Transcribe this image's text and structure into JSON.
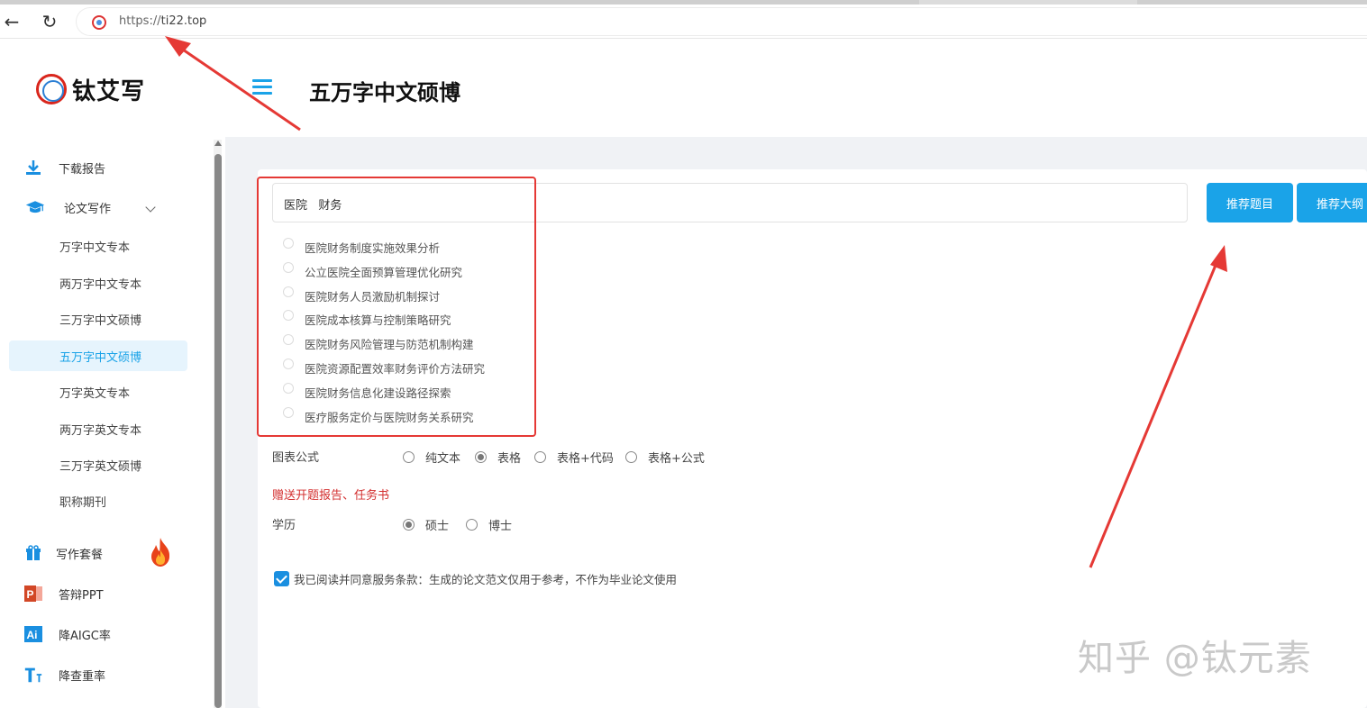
{
  "browser": {
    "url_scheme": "https://",
    "url_host": "ti22.top"
  },
  "sidebar": {
    "brand": "钛艾写",
    "items": [
      {
        "label": "下载报告",
        "icon": "download-icon"
      },
      {
        "label": "论文写作",
        "icon": "graduation-cap-icon"
      }
    ],
    "subitems": [
      "万字中文专本",
      "两万字中文专本",
      "三万字中文硕博",
      "五万字中文硕博",
      "万字英文专本",
      "两万字英文专本",
      "三万字英文硕博",
      "职称期刊"
    ],
    "active_subitem": "五万字中文硕博",
    "bottom_items": [
      {
        "label": "写作套餐",
        "icon": "gift-icon"
      },
      {
        "label": "答辩PPT",
        "icon": "ppt-icon"
      },
      {
        "label": "降AIGC率",
        "icon": "ai-icon"
      },
      {
        "label": "降查重率",
        "icon": "text-icon"
      }
    ]
  },
  "header": {
    "title": "五万字中文硕博"
  },
  "form": {
    "topic_value": "医院   财务",
    "buttons": {
      "recommend_topic": "推荐题目",
      "recommend_outline": "推荐大纲"
    },
    "suggestions": [
      "医院财务制度实施效果分析",
      "公立医院全面预算管理优化研究",
      "医院财务人员激励机制探讨",
      "医院成本核算与控制策略研究",
      "医院财务风险管理与防范机制构建",
      "医院资源配置效率财务评价方法研究",
      "医院财务信息化建设路径探索",
      "医疗服务定价与医院财务关系研究"
    ],
    "chart_formula": {
      "label": "图表公式",
      "options": [
        "纯文本",
        "表格",
        "表格+代码",
        "表格+公式"
      ],
      "selected": "表格"
    },
    "gift_text": "赠送开题报告、任务书",
    "degree": {
      "label": "学历",
      "options": [
        "硕士",
        "博士"
      ],
      "selected": "硕士"
    },
    "agree_text": "我已阅读并同意服务条款：生成的论文范文仅用于参考，不作为毕业论文使用",
    "agree_checked": true
  },
  "watermark": "知乎 @钛元素",
  "colors": {
    "accent": "#1aa3e8",
    "annotation_red": "#e53935"
  }
}
